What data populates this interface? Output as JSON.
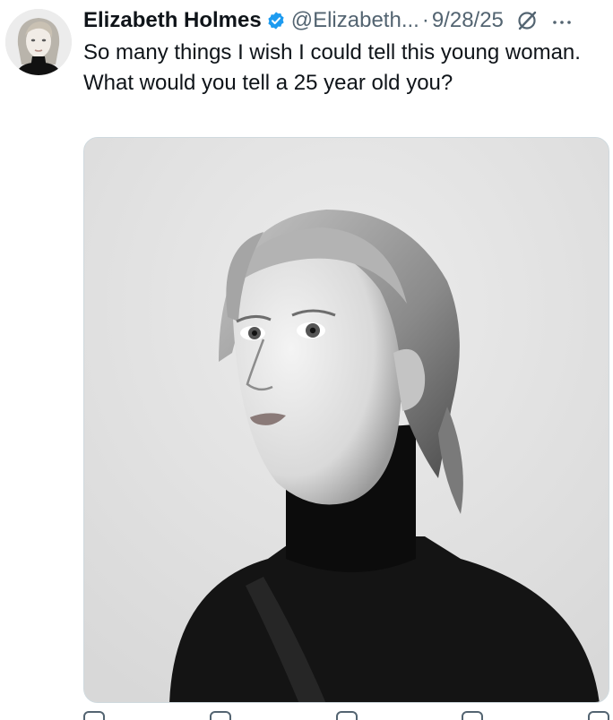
{
  "tweet": {
    "author_name": "Elizabeth Holmes",
    "handle": "@Elizabeth...",
    "separator": "·",
    "date": "9/28/25",
    "text_lines": [
      "So many things I wish I could tell this young woman.",
      "What would you tell a 25 year old you?"
    ]
  },
  "icons": {
    "verified": "verified-badge-icon",
    "grok": "grok-icon",
    "more": "more-options-icon"
  },
  "colors": {
    "text": "#0f1419",
    "secondary": "#536471",
    "verified": "#1d9bf0"
  }
}
